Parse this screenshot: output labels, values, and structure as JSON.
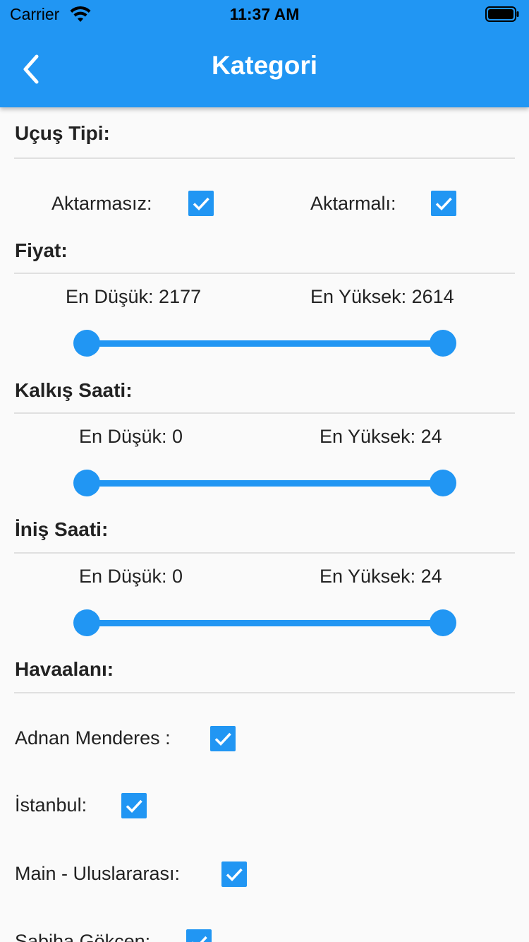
{
  "status_bar": {
    "carrier": "Carrier",
    "time": "11:37 AM"
  },
  "app_bar": {
    "title": "Kategori",
    "back_icon": "chevron-left-icon"
  },
  "colors": {
    "primary": "#2196f3",
    "background": "#fafafa"
  },
  "flight_type": {
    "title": "Uçuş Tipi:",
    "options": [
      {
        "label": "Aktarmasız:",
        "checked": true
      },
      {
        "label": "Aktarmalı:",
        "checked": true
      }
    ]
  },
  "price": {
    "title": "Fiyat:",
    "min_label": "En Düşük: 2177",
    "max_label": "En Yüksek: 2614",
    "min": 2177,
    "max": 2614
  },
  "departure_time": {
    "title": "Kalkış Saati:",
    "min_label": "En Düşük: 0",
    "max_label": "En Yüksek: 24",
    "min": 0,
    "max": 24
  },
  "arrival_time": {
    "title": "İniş Saati:",
    "min_label": "En Düşük: 0",
    "max_label": "En Yüksek: 24",
    "min": 0,
    "max": 24
  },
  "airport": {
    "title": "Havaalanı:",
    "options": [
      {
        "label": "Adnan Menderes :",
        "checked": true
      },
      {
        "label": "İstanbul:",
        "checked": true
      },
      {
        "label": "Main - Uluslararası:",
        "checked": true
      },
      {
        "label": "Sabiha Gökçen:",
        "checked": true
      }
    ]
  }
}
